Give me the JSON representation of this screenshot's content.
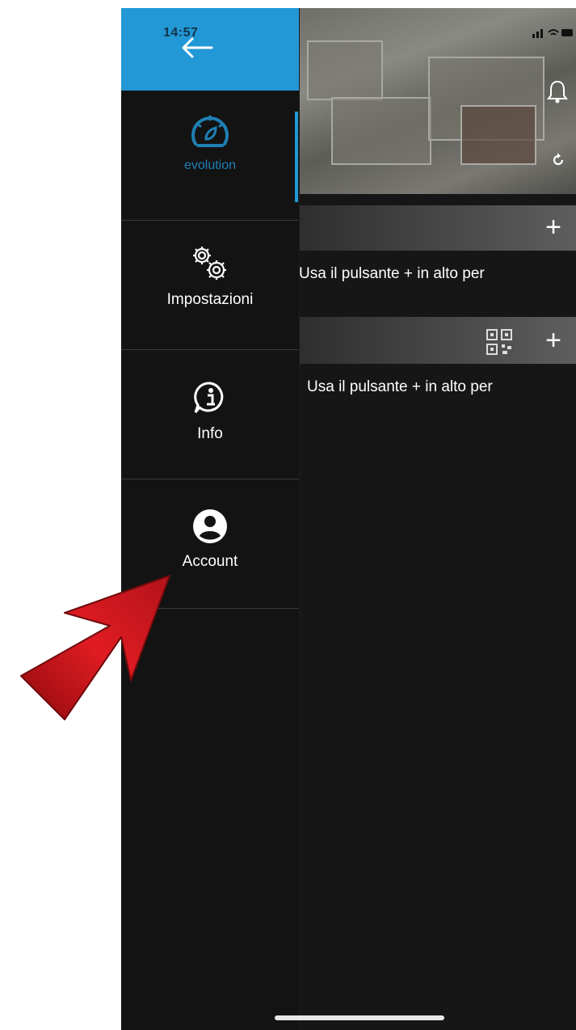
{
  "status_bar": {
    "time": "14:57"
  },
  "drawer": {
    "items": [
      {
        "label": "evolution",
        "icon": "speedometer-icon",
        "active": true
      },
      {
        "label": "Impostazioni",
        "icon": "gears-icon"
      },
      {
        "label": "Info",
        "icon": "info-bubble-icon"
      },
      {
        "label": "Account",
        "icon": "account-circle-icon"
      }
    ]
  },
  "content": {
    "sections": [
      {
        "hint": "Usa il pulsante + in alto per",
        "action": "+"
      },
      {
        "hint": "Usa il pulsante + in alto per",
        "action": "+"
      }
    ]
  },
  "colors": {
    "accent": "#2298d6",
    "drawer_bg": "#131313",
    "annotation": "#d3141a"
  }
}
